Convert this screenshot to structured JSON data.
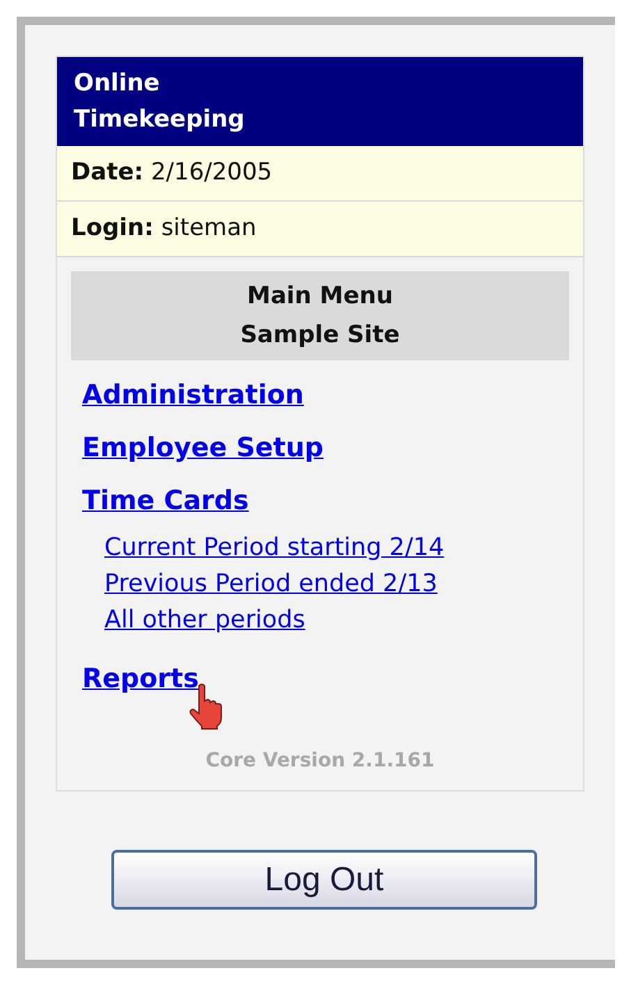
{
  "header": {
    "title_lines": [
      "Online",
      "Timekeeping"
    ]
  },
  "info": [
    {
      "label": "Date:",
      "value": "2/16/2005"
    },
    {
      "label": "Login:",
      "value": "siteman"
    }
  ],
  "menu": {
    "title_lines": [
      "Main Menu",
      "Sample Site"
    ],
    "items": [
      {
        "label": "Administration"
      },
      {
        "label": "Employee Setup"
      },
      {
        "label": "Time Cards",
        "children": [
          {
            "label": "Current Period starting 2/14"
          },
          {
            "label": "Previous Period ended 2/13"
          },
          {
            "label": "All other periods"
          }
        ]
      },
      {
        "label": "Reports",
        "hovered": true
      }
    ]
  },
  "version": "Core Version 2.1.161",
  "button": "Log Out"
}
